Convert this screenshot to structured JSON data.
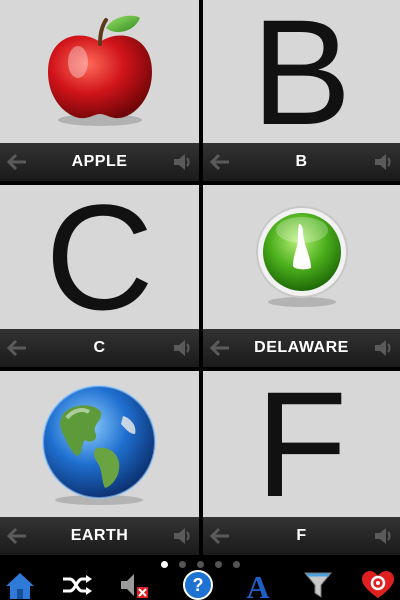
{
  "cards": [
    {
      "label": "APPLE",
      "icon": "apple-icon"
    },
    {
      "label": "B",
      "letter": "B"
    },
    {
      "label": "C",
      "letter": "C"
    },
    {
      "label": "DELAWARE",
      "icon": "delaware-state-icon"
    },
    {
      "label": "EARTH",
      "icon": "earth-globe-icon"
    },
    {
      "label": "F",
      "letter": "F"
    }
  ],
  "pager": {
    "pages": 5,
    "current": 1
  },
  "toolbar": {
    "items": [
      "home-icon",
      "shuffle-icon",
      "sound-off-icon",
      "help-icon",
      "font-icon",
      "filter-icon",
      "heart-settings-icon"
    ]
  },
  "colors": {
    "card_bg": "#d7d7d7",
    "label_bar": "#262626",
    "toolbar_bg": "#000000",
    "accent_blue": "#1e73d2"
  }
}
